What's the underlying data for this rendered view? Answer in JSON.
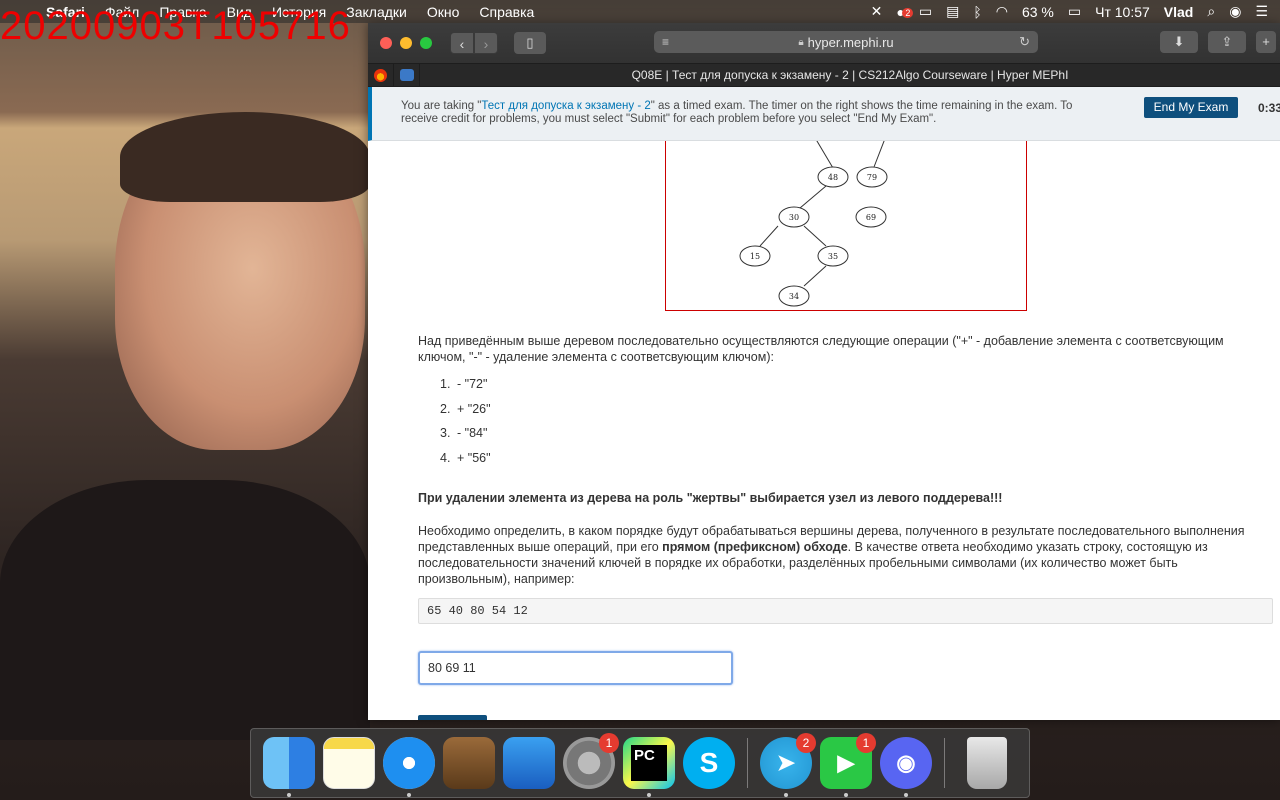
{
  "overlay": {
    "timestamp": "20200903T105716"
  },
  "menubar": {
    "app_name": "Safari",
    "items": [
      "Файл",
      "Правка",
      "Вид",
      "История",
      "Закладки",
      "Окно",
      "Справка"
    ],
    "notification_badge": "2",
    "battery": "63 %",
    "clock": "Чт 10:57",
    "user": "Vlad"
  },
  "browser": {
    "url": "hyper.mephi.ru",
    "tab_title": "Q08E | Тест для допуска к экзамену - 2 | CS212Algo Courseware | Hyper MEPhI"
  },
  "exam_banner": {
    "text_before": "You are taking \"",
    "exam_link": "Тест для допуска к экзамену - 2",
    "text_after": "\" as a timed exam. The timer on the right shows the time remaining in the exam. To receive credit for problems, you must select \"Submit\" for each problem before you select \"End My Exam\".",
    "end_button": "End My Exam",
    "timer": "0:33:"
  },
  "tree": {
    "nodes": [
      {
        "key": "48"
      },
      {
        "key": "79"
      },
      {
        "key": "30"
      },
      {
        "key": "69"
      },
      {
        "key": "15"
      },
      {
        "key": "35"
      },
      {
        "key": "34"
      }
    ]
  },
  "problem": {
    "intro": "Над приведённым выше деревом последовательно осуществляются следующие операции (\"+\" - добавление элемента с соответсвующим ключом, \"-\" - удаление элемента с соответсвующим ключом):",
    "operations": [
      {
        "num": "1.",
        "op": "- \"72\""
      },
      {
        "num": "2.",
        "op": "+ \"26\""
      },
      {
        "num": "3.",
        "op": "- \"84\""
      },
      {
        "num": "4.",
        "op": "+ \"56\""
      }
    ],
    "note": "При удалении элемента из дерева на роль \"жертвы\" выбирается узел из левого поддерева!!!",
    "task_before": "Необходимо определить, в каком порядке будут обрабатываться вершины дерева, полученного в результате последовательного выполнения представленных выше операций, при его ",
    "task_bold": "прямом (префиксном) обходе",
    "task_after": ". В качестве ответа необходимо указать строку, состоящую из последовательности значений ключей в порядке их обработки, разделённых пробельными символами (их количество может быть произвольным), например:",
    "example": "65 40 80 54 12",
    "answer_value": "80 69 11"
  },
  "dock": {
    "badges": {
      "system_prefs": "1",
      "telegram": "2",
      "facetime": "1"
    },
    "pycharm_label": "PC"
  }
}
